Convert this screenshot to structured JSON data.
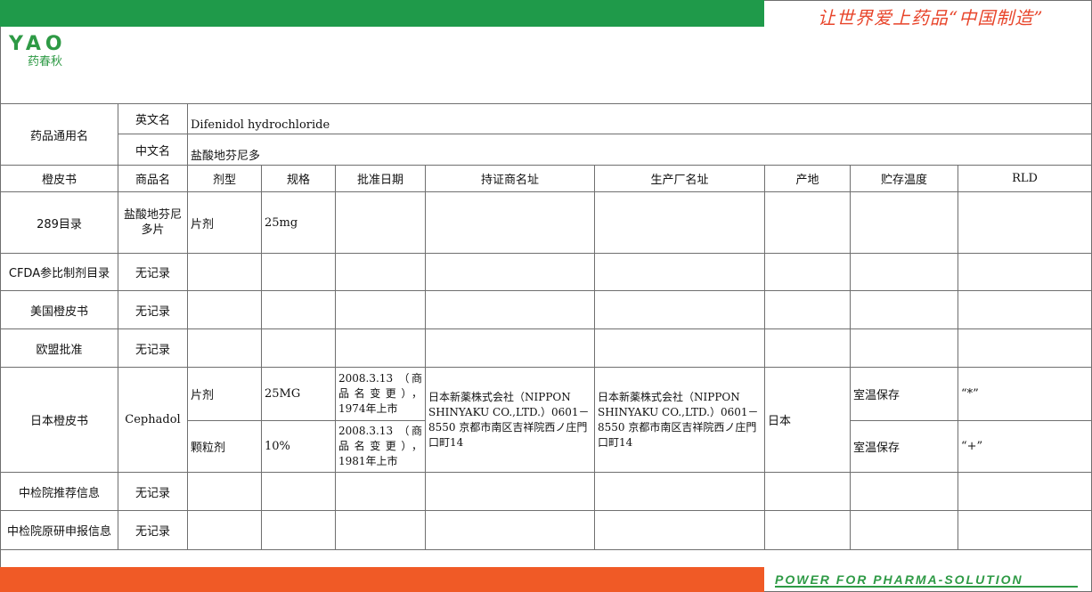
{
  "header": {
    "slogan": "让世界爱上药品“中国制造”",
    "logo_text": "YAO",
    "logo_cn": "药春秋"
  },
  "footer": {
    "slogan": "POWER FOR PHARMA-SOLUTION"
  },
  "colors": {
    "green": "#1f9a4a",
    "orange": "#f05a26",
    "slogan_red": "#e8452b"
  },
  "drug": {
    "label": "药品通用名",
    "en_label": "英文名",
    "en_name": "Difenidol hydrochloride",
    "cn_label": "中文名",
    "cn_name": "盐酸地芬尼多"
  },
  "columns": [
    "橙皮书",
    "商品名",
    "剂型",
    "规格",
    "批准日期",
    "持证商名址",
    "生产厂名址",
    "产地",
    "贮存温度",
    "RLD"
  ],
  "rows": {
    "r289": {
      "source": "289目录",
      "trade": "盐酸地芬尼多片",
      "form": "片剂",
      "spec": "25mg"
    },
    "cfda": {
      "source": "CFDA参比制剂目录",
      "trade": "无记录"
    },
    "us": {
      "source": "美国橙皮书",
      "trade": "无记录"
    },
    "eu": {
      "source": "欧盟批准",
      "trade": "无记录"
    },
    "jp": {
      "source": "日本橙皮书",
      "trade": "Cephadol",
      "holder": "日本新薬株式会社（NIPPON SHINYAKU CO.,LTD.）0601－8550 京都市南区吉祥院西ノ庄門口町14",
      "maker": "日本新薬株式会社（NIPPON SHINYAKU CO.,LTD.）0601－8550 京都市南区吉祥院西ノ庄門口町14",
      "origin": "日本",
      "items": [
        {
          "form": "片剂",
          "spec": "25MG",
          "date": "2008.3.13 （商品名变更），1974年上市",
          "storage": "室温保存",
          "rld": "“*”"
        },
        {
          "form": "颗粒剂",
          "spec": "10%",
          "date": "2008.3.13 （商品名变更），1981年上市",
          "storage": "室温保存",
          "rld": "“+”"
        }
      ]
    },
    "nifdc_rec": {
      "source": "中检院推荐信息",
      "trade": "无记录"
    },
    "nifdc_orig": {
      "source": "中检院原研申报信息",
      "trade": "无记录"
    }
  }
}
